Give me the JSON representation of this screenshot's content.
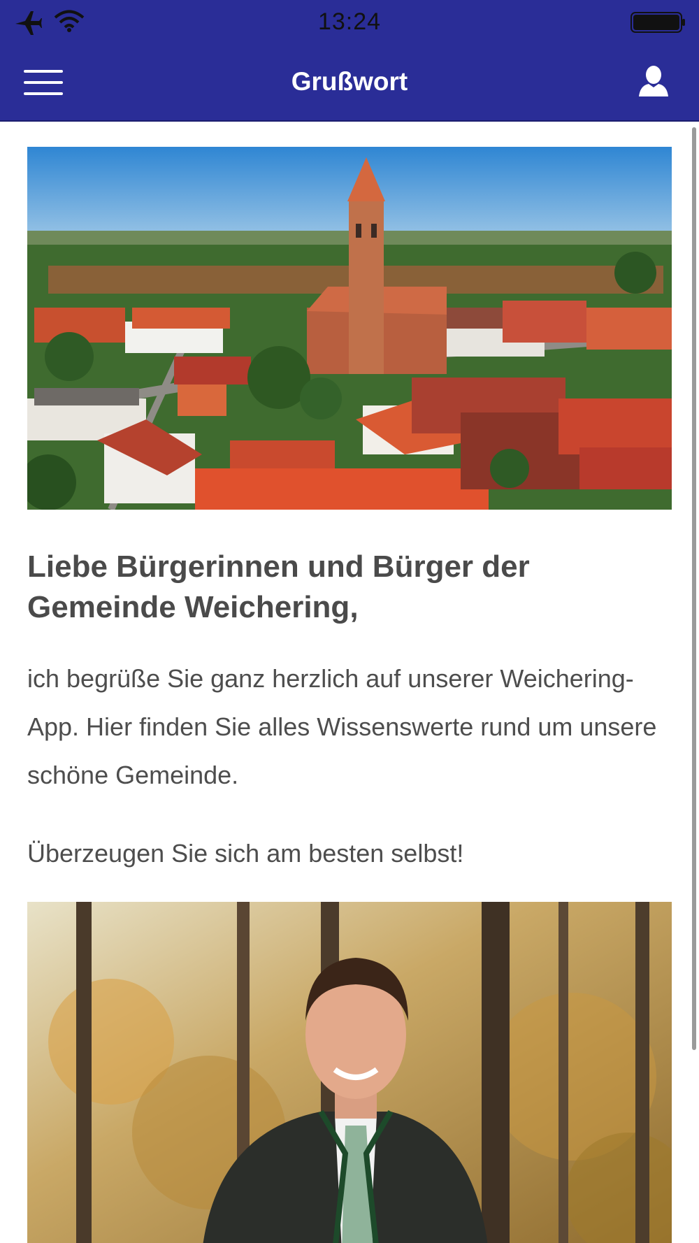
{
  "status_bar": {
    "time": "13:24",
    "icons": [
      "airplane-icon",
      "wifi-icon",
      "battery-icon"
    ]
  },
  "nav": {
    "title": "Grußwort",
    "menu_icon": "hamburger-menu-icon",
    "profile_icon": "user-profile-icon"
  },
  "colors": {
    "header_bg": "#2a2d97",
    "text": "#4d4d4d",
    "heading": "#4a4a4a"
  },
  "article": {
    "heading": "Liebe Bürgerinnen und Bürger der Gemeinde Weichering,",
    "paragraphs": [
      "ich begrüße Sie ganz herzlich auf unserer Weichering-App. Hier finden Sie alles Wissenswerte rund um unsere schöne Gemeinde.",
      "Überzeugen Sie sich am besten selbst!"
    ]
  }
}
